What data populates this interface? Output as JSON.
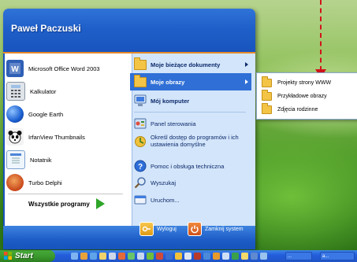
{
  "user": {
    "name": "Paweł Paczuski"
  },
  "left_programs": [
    {
      "label": "Microsoft Office Word 2003",
      "icon": "word-icon"
    },
    {
      "label": "Kalkulator",
      "icon": "calculator-icon"
    },
    {
      "label": "Google Earth",
      "icon": "globe-icon"
    },
    {
      "label": "IrfanView Thumbnails",
      "icon": "panda-icon"
    },
    {
      "label": "Notatnik",
      "icon": "notepad-icon"
    },
    {
      "label": "Turbo Delphi",
      "icon": "delphi-icon"
    }
  ],
  "all_programs": {
    "label": "Wszystkie programy"
  },
  "right_items": {
    "documents": "Moje bieżące dokumenty",
    "pictures": "Moje obrazy",
    "computer": "Mój komputer",
    "control_panel": "Panel sterowania",
    "access": "Określ dostęp do programów i ich ustawienia domyślne",
    "help": "Pomoc i obsługa techniczna",
    "search": "Wyszukaj",
    "run": "Uruchom..."
  },
  "submenu": [
    {
      "label": "Projekty strony WWW"
    },
    {
      "label": "Przykładowe obrazy"
    },
    {
      "label": "Zdjęcia rodzinne"
    }
  ],
  "footer": {
    "logoff": "Wyloguj",
    "shutdown": "Zamknij system"
  },
  "taskbar": {
    "start": "Start",
    "task1": "...",
    "task2": "a..."
  },
  "colors": {
    "menu_blue": "#1954be",
    "selection": "#2f6fd6",
    "arrow_red": "#d2141b",
    "start_green": "#3b9a2e"
  }
}
